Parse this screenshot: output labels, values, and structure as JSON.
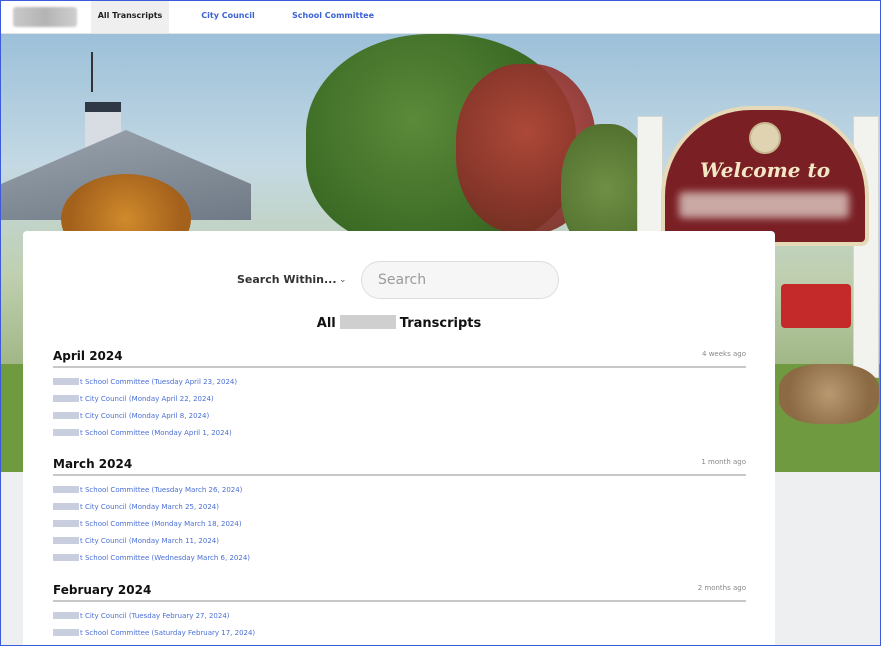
{
  "nav": {
    "tabs": [
      {
        "label": "All Transcripts",
        "active": true
      },
      {
        "label": "City Council",
        "active": false
      },
      {
        "label": "School Committee",
        "active": false
      }
    ]
  },
  "hero": {
    "sign_text": "Welcome to"
  },
  "search": {
    "within_label": "Search Within...",
    "placeholder": "Search"
  },
  "page_title": {
    "prefix": "All",
    "suffix": "Transcripts"
  },
  "sections": [
    {
      "month": "April 2024",
      "age": "4 weeks ago",
      "items": [
        "t School Committee (Tuesday April 23, 2024)",
        "t City Council (Monday April 22, 2024)",
        "t City Council (Monday April 8, 2024)",
        "t School Committee (Monday April 1, 2024)"
      ]
    },
    {
      "month": "March 2024",
      "age": "1 month ago",
      "items": [
        "t School Committee (Tuesday March 26, 2024)",
        "t City Council (Monday March 25, 2024)",
        "t School Committee (Monday March 18, 2024)",
        "t City Council (Monday March 11, 2024)",
        "t School Committee (Wednesday March 6, 2024)"
      ]
    },
    {
      "month": "February 2024",
      "age": "2 months ago",
      "items": [
        "t City Council (Tuesday February 27, 2024)",
        "t School Committee (Saturday February 17, 2024)"
      ]
    }
  ],
  "colors": {
    "link": "#4a6fd6",
    "nav_link": "#3b62d6",
    "frame_border": "#3b5bdb"
  }
}
